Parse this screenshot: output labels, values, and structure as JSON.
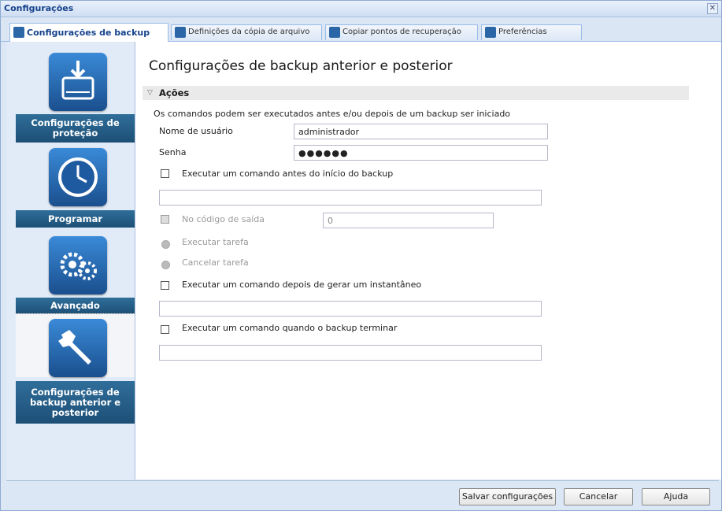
{
  "window": {
    "title": "Configurações"
  },
  "tabs": [
    {
      "label": "Configurações de backup",
      "active": true,
      "icon": "backup-icon"
    },
    {
      "label": "Definições da cópia de arquivo",
      "active": false,
      "icon": "file-copy-icon"
    },
    {
      "label": "Copiar pontos de recuperação",
      "active": false,
      "icon": "recovery-point-icon"
    },
    {
      "label": "Preferências",
      "active": false,
      "icon": "preferences-icon"
    }
  ],
  "sidebar": {
    "items": [
      {
        "label": "Configurações de proteção",
        "icon": "protection-icon"
      },
      {
        "label": "Programar",
        "icon": "schedule-icon"
      },
      {
        "label": "Avançado",
        "icon": "gears-icon"
      },
      {
        "label": "Configurações de backup anterior e posterior",
        "icon": "wrench-icon",
        "selected": true
      }
    ]
  },
  "main": {
    "heading": "Configurações de backup anterior e posterior",
    "section_title": "Ações",
    "description": "Os comandos podem ser executados antes e/ou depois de um backup ser iniciado",
    "username_label": "Nome de usuário",
    "username_value": "administrador",
    "password_label": "Senha",
    "password_value": "●●●●●●",
    "pre_command_label": "Executar um comando antes do início do backup",
    "pre_command_value": "",
    "exit_code_label": "No código de saída",
    "exit_code_value": "0",
    "run_job_label": "Executar tarefa",
    "cancel_job_label": "Cancelar tarefa",
    "post_snapshot_label": "Executar um comando depois de gerar um instantâneo",
    "post_snapshot_value": "",
    "post_backup_label": "Executar um comando quando o backup terminar",
    "post_backup_value": ""
  },
  "footer": {
    "save_label": "Salvar configurações",
    "cancel_label": "Cancelar",
    "help_label": "Ajuda"
  },
  "colors": {
    "accent": "#15428b",
    "nav_label": "#1d4f76",
    "tile": "#2b66a7"
  }
}
